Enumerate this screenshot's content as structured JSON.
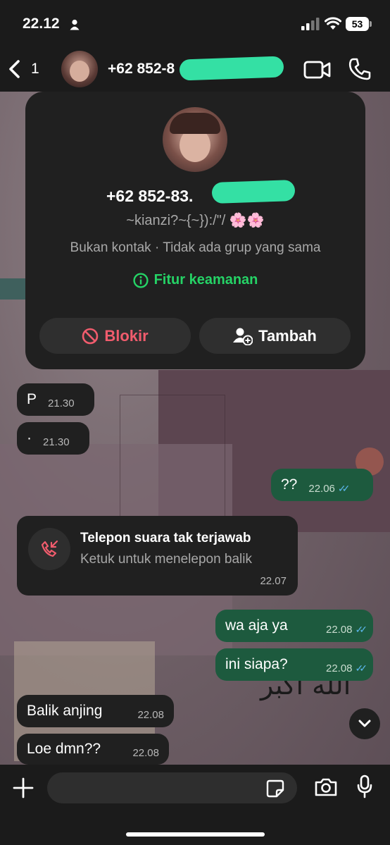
{
  "status_bar": {
    "time": "22.12",
    "battery": "53"
  },
  "header": {
    "back_count": "1",
    "contact_name": "+62 852-8"
  },
  "contact_card": {
    "phone": "+62 852-83.",
    "about": "~kianzi?~{~}):/\"/ 🌸🌸",
    "info": "Bukan kontak · Tidak ada grup yang sama",
    "security_label": "Fitur keamanan",
    "block_label": "Blokir",
    "add_label": "Tambah"
  },
  "messages": [
    {
      "text": "P",
      "time": "21.30",
      "dir": "in"
    },
    {
      "text": "·",
      "time": "21.30",
      "dir": "in"
    },
    {
      "text": "??",
      "time": "22.06",
      "dir": "out"
    },
    {
      "text": "wa aja ya",
      "time": "22.08",
      "dir": "out"
    },
    {
      "text": "ini siapa?",
      "time": "22.08",
      "dir": "out"
    },
    {
      "text": "Balik anjing",
      "time": "22.08",
      "dir": "in"
    },
    {
      "text": "Loe dmn??",
      "time": "22.08",
      "dir": "in"
    }
  ],
  "missed_call": {
    "title": "Telepon suara tak terjawab",
    "subtitle": "Ketuk untuk menelepon balik",
    "time": "22.07"
  },
  "colors": {
    "accent_green": "#25d366",
    "block_red": "#f15c6d",
    "out_bubble": "#1d5a3e",
    "in_bubble": "#202020",
    "read_ticks": "#5bb7ec"
  },
  "icons": [
    "person-icon",
    "signal-icon",
    "wifi-icon",
    "battery-icon",
    "back-chevron-icon",
    "video-call-icon",
    "phone-icon",
    "info-icon",
    "block-icon",
    "add-contact-icon",
    "missed-call-icon",
    "scroll-down-icon",
    "plus-icon",
    "sticker-icon",
    "camera-icon",
    "mic-icon"
  ]
}
